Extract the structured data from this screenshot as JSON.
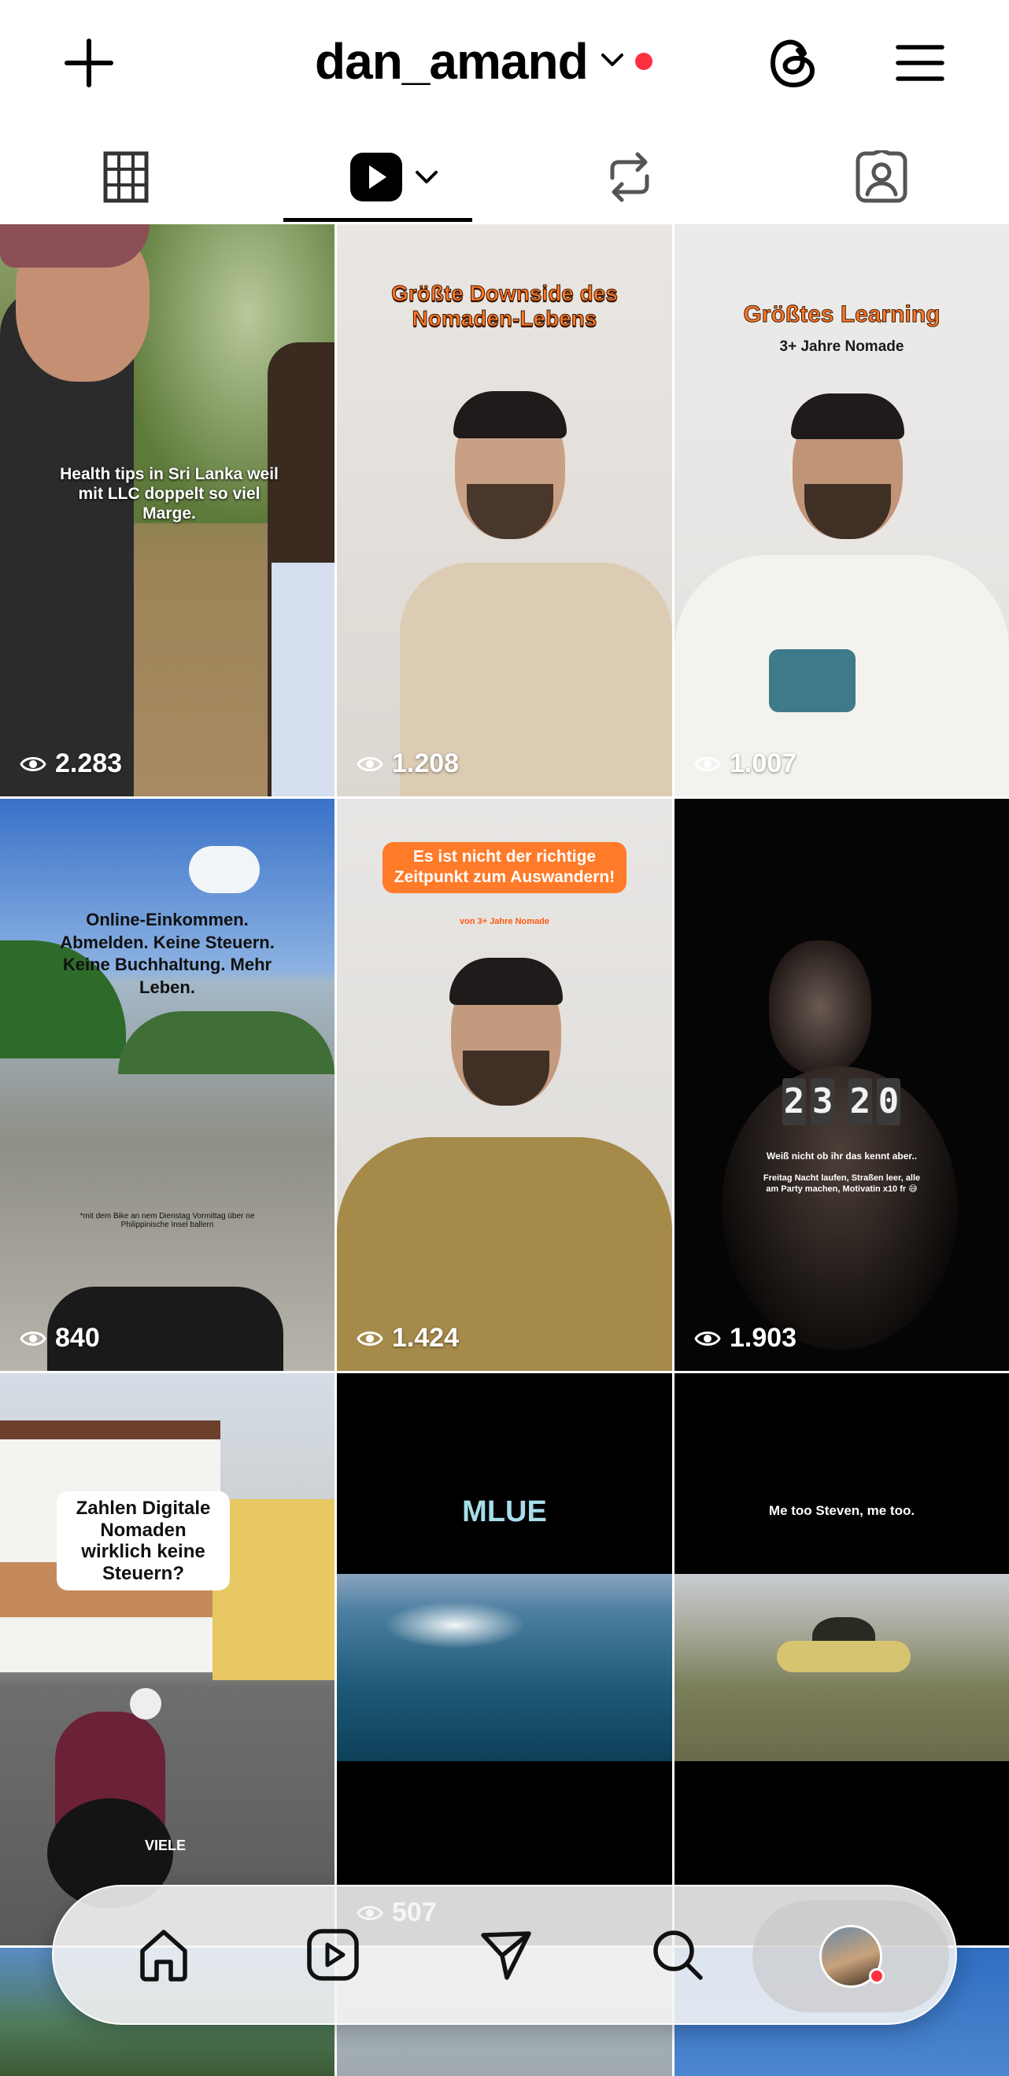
{
  "header": {
    "username": "dan_amand",
    "has_notification": true,
    "icons": [
      "plus-icon",
      "chevron-down-icon",
      "threads-icon",
      "menu-icon"
    ]
  },
  "tabs": [
    {
      "name": "grid",
      "icon": "grid-icon",
      "active": false
    },
    {
      "name": "reels",
      "icon": "reels-icon",
      "active": true
    },
    {
      "name": "reposts",
      "icon": "repost-icon",
      "active": false
    },
    {
      "name": "tagged",
      "icon": "tagged-icon",
      "active": false
    }
  ],
  "reels": [
    {
      "caption": "Health tips in Sri Lanka weil mit LLC doppelt so viel Marge.",
      "views": "2.283"
    },
    {
      "caption": "Größte Downside des Nomaden-Lebens",
      "views": "1.208"
    },
    {
      "caption": "Größtes Learning",
      "subcaption": "3+ Jahre Nomade",
      "views": "1.007"
    },
    {
      "caption": "Online-Einkommen. Abmelden. Keine Steuern. Keine Buchhaltung. Mehr Leben.",
      "subcaption": "*mit dem Bike an nem Dienstag Vormittag über ne Philippinische Insel ballern",
      "views": "840"
    },
    {
      "caption": "Es ist nicht der richtige Zeitpunkt zum Auswandern!",
      "subcaption": "von 3+ Jahre Nomade",
      "views": "1.424"
    },
    {
      "caption": "Weiß nicht ob ihr das kennt aber..",
      "subcaption": "Freitag Nacht laufen, Straßen leer, alle am Party machen, Motivatin x10 fr 😅",
      "clock": "2320",
      "views": "1.903"
    },
    {
      "caption": "Zahlen Digitale Nomaden wirklich keine Steuern?",
      "subcaption": "VIELE",
      "views": ""
    },
    {
      "caption": "MLUE",
      "views": "507"
    },
    {
      "caption": "Me too Steven, me too.",
      "views": ""
    }
  ],
  "bottom_nav": {
    "items": [
      "home-icon",
      "reels-icon",
      "send-icon",
      "search-icon",
      "profile-avatar"
    ],
    "active": "profile-avatar"
  }
}
